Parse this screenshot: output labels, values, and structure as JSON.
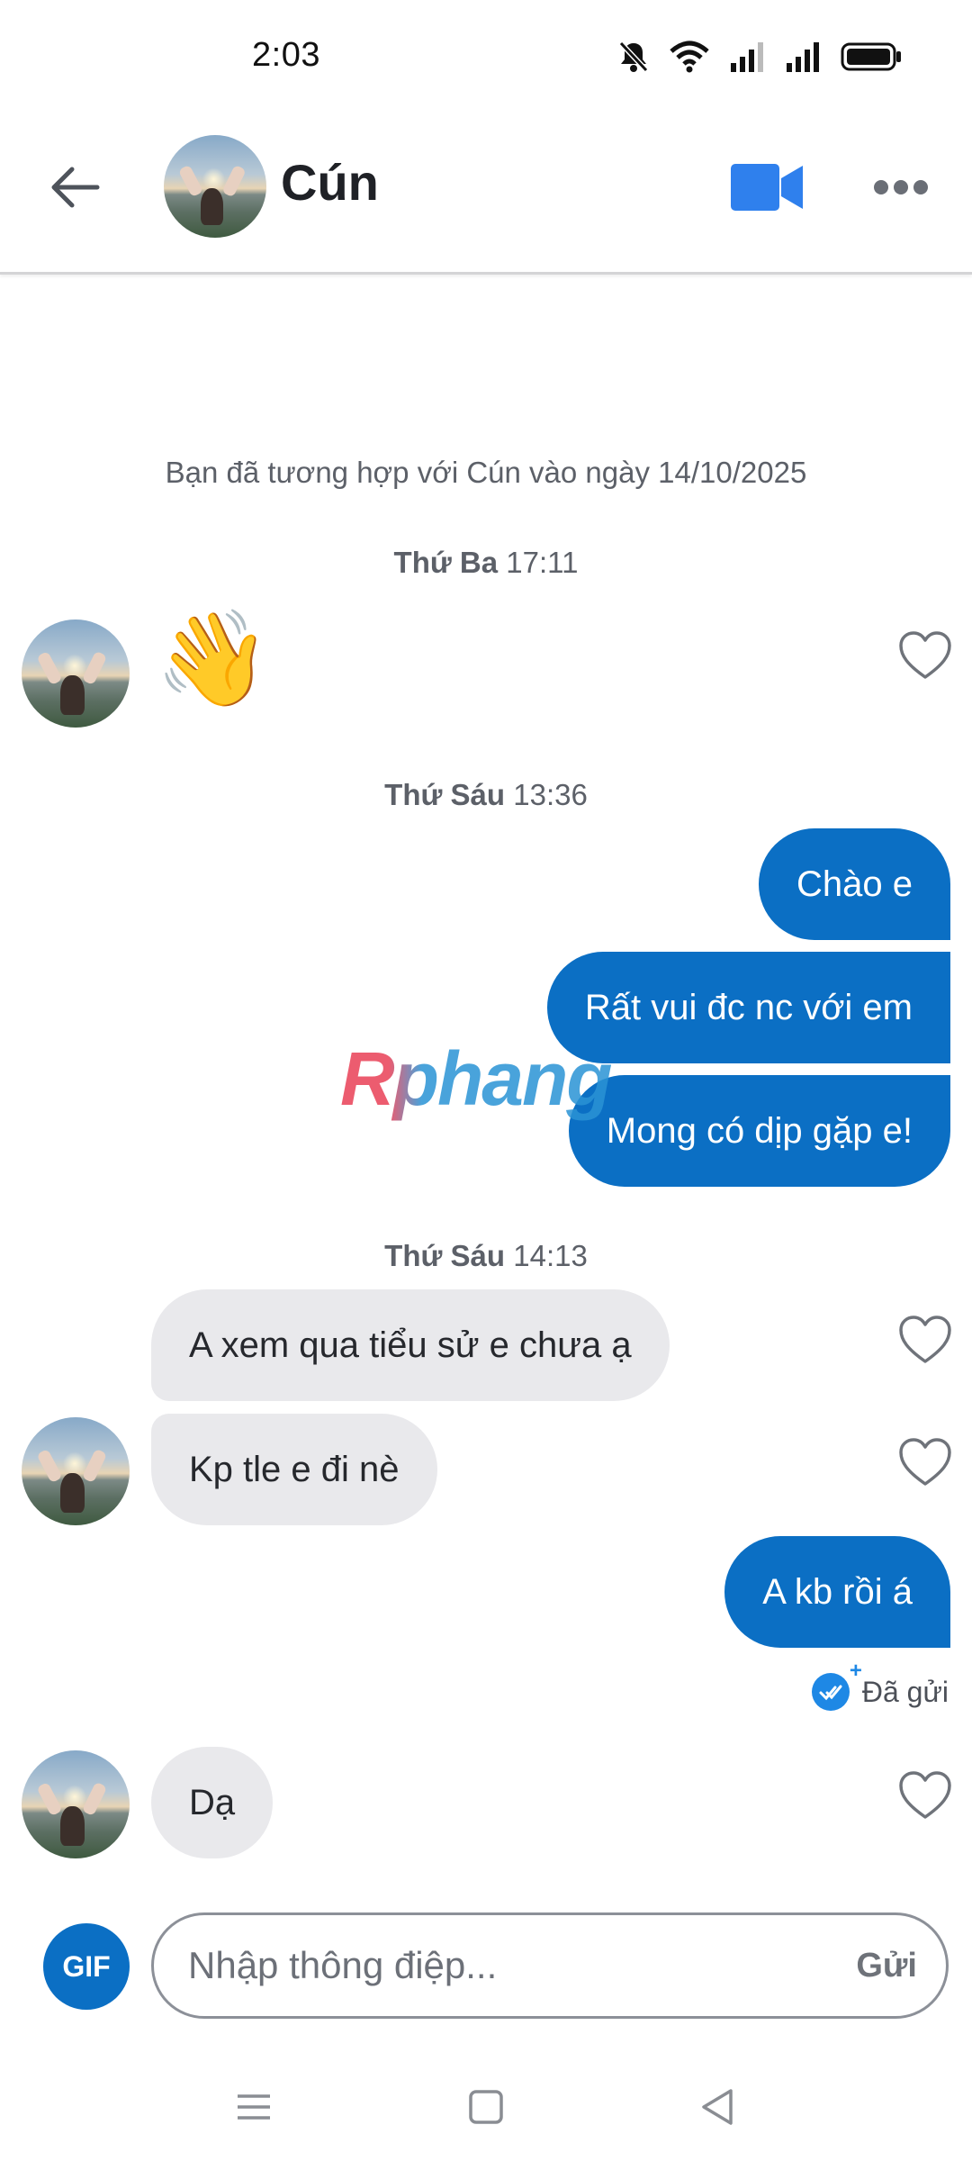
{
  "status_bar": {
    "time": "2:03"
  },
  "header": {
    "contact_name": "Cún"
  },
  "match_notice": "Bạn đã tương hợp với Cún vào ngày 14/10/2025",
  "groups": [
    {
      "day": "Thứ Ba",
      "time": "17:11"
    },
    {
      "day": "Thứ Sáu",
      "time": "13:36"
    },
    {
      "day": "Thứ Sáu",
      "time": "14:13"
    }
  ],
  "messages": {
    "wave_emoji": "👋",
    "out1": "Chào e",
    "out2": "Rất vui đc nc với em",
    "out3": "Mong có dịp gặp e!",
    "in1": "A xem qua tiểu sử e chưa ạ",
    "in2": "Kp tle e đi nè",
    "out4": "A kb rồi á",
    "in3": "Dạ"
  },
  "sent_status": "Đã gửi",
  "watermark": "Rphang",
  "composer": {
    "gif_label": "GIF",
    "placeholder": "Nhập thông điệp...",
    "send_label": "Gửi"
  },
  "colors": {
    "accent": "#0b6fc4",
    "incoming_bubble": "#e9e9ec",
    "video_icon": "#2f80ed"
  }
}
